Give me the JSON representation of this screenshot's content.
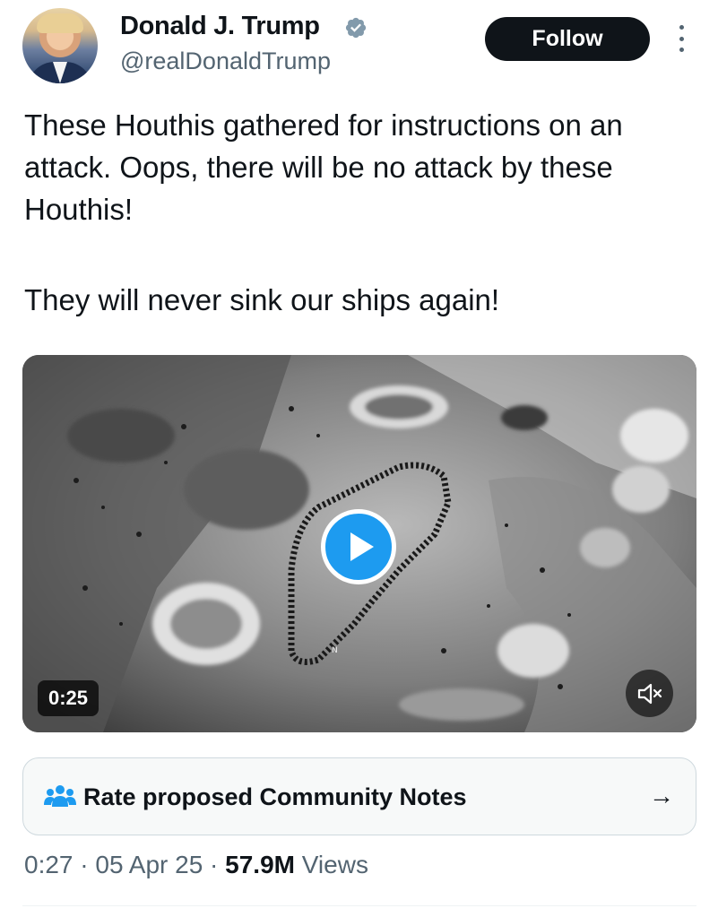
{
  "author": {
    "display_name": "Donald J. Trump",
    "handle": "@realDonaldTrump",
    "verified": true
  },
  "follow_label": "Follow",
  "tweet": {
    "paragraph_1": "These Houthis gathered for instructions on an attack. Oops, there will be no attack by these Houthis!",
    "paragraph_2": "They will never sink our ships again!"
  },
  "media": {
    "duration": "0:25",
    "compass_label": "N"
  },
  "community_notes": {
    "label": "Rate proposed Community Notes",
    "arrow": "→"
  },
  "meta": {
    "time": "0:27",
    "date": "05 Apr 25",
    "views_count": "57.9M",
    "views_label": "Views",
    "separator": "·"
  },
  "icons": {
    "verified": "verified-badge-icon",
    "more": "more-vertical-icon",
    "play": "play-icon",
    "mute": "speaker-muted-icon",
    "community": "community-people-icon",
    "arrow": "arrow-right-icon"
  },
  "colors": {
    "accent": "#1d9bf0",
    "text": "#0f1419",
    "secondary": "#536471",
    "follow_bg": "#0f1419"
  }
}
